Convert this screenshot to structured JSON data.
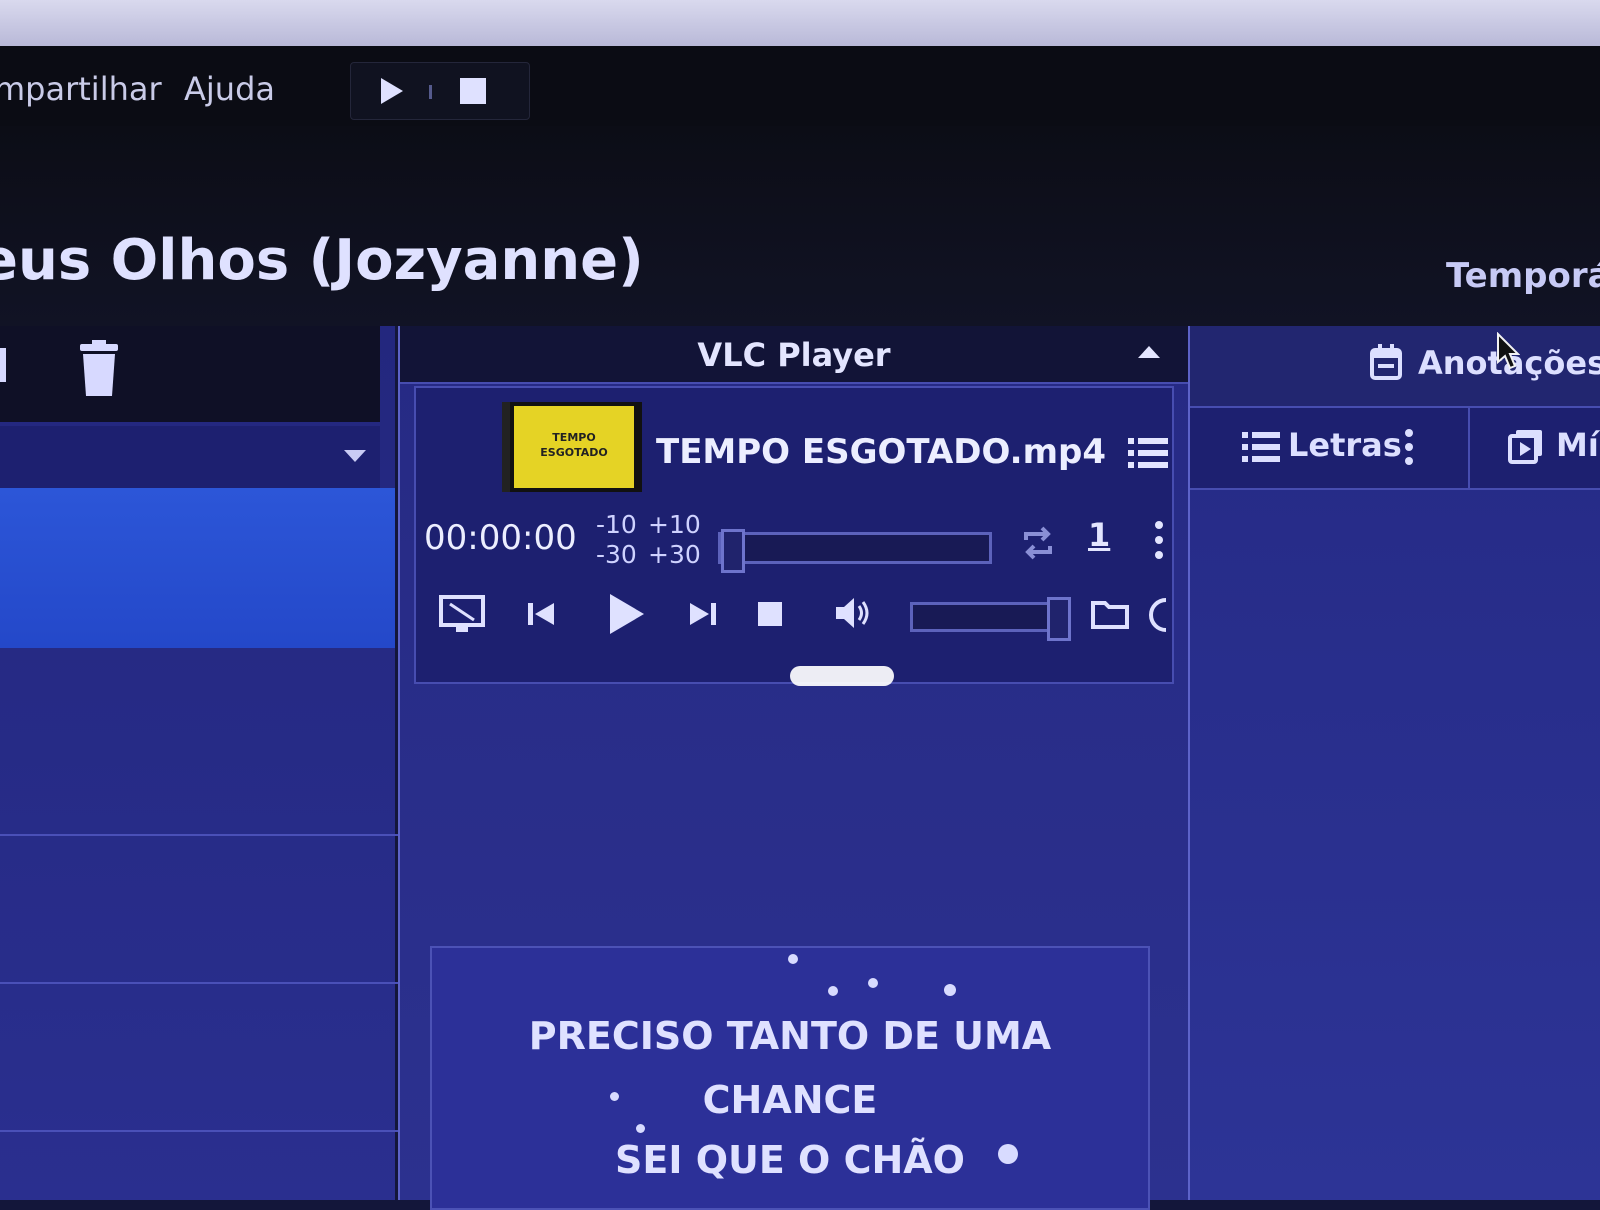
{
  "menu": {
    "items": [
      "mpartilhar",
      "Ajuda"
    ]
  },
  "header": {
    "song_title": "eus Olhos  (Jozyanne)",
    "right_label": "Temporár"
  },
  "vlc": {
    "title": "VLC Player",
    "file_name": "TEMPO ESGOTADO.mp4",
    "thumb_text_1": "TEMPO",
    "thumb_text_2": "ESGOTADO",
    "time": "00:00:00",
    "skip_back_10": "-10",
    "skip_fwd_10": "+10",
    "skip_back_30": "-30",
    "skip_fwd_30": "+30",
    "speed": "1",
    "seek_progress": 0,
    "volume_level": 1
  },
  "lyrics": {
    "line1": "PRECISO TANTO DE UMA",
    "line2": "CHANCE",
    "line3": "SEI QUE O CHÃO"
  },
  "right": {
    "annotations_label": "Anotações",
    "lyrics_tab": "Letras",
    "media_tab": "Míc"
  },
  "colors": {
    "panel_bg": "#262a86",
    "selection": "#2c56d8",
    "thumb_yellow": "#e5d325",
    "menubar": "#0b0c14"
  }
}
